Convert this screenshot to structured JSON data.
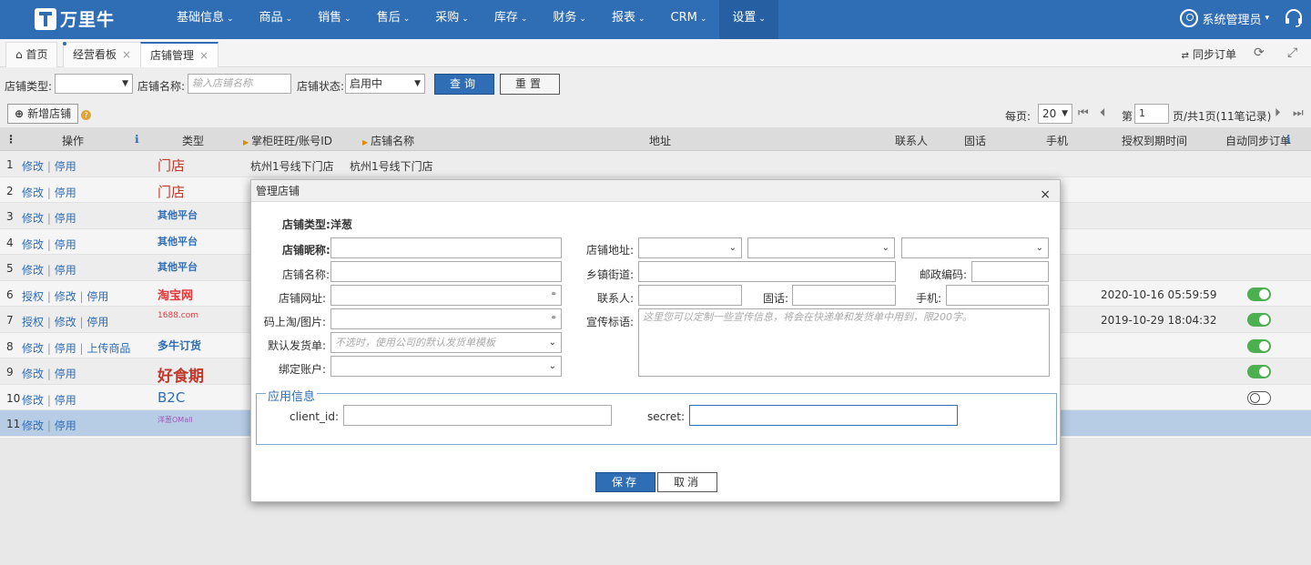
{
  "app": {
    "logo_text": "万里牛"
  },
  "nav": {
    "items": [
      "基础信息",
      "商品",
      "销售",
      "售后",
      "采购",
      "库存",
      "财务",
      "报表",
      "CRM",
      "设置"
    ],
    "active_index": 9
  },
  "user": {
    "name": "系统管理员"
  },
  "tabs": [
    {
      "label": "首页"
    },
    {
      "label": "经营看板"
    },
    {
      "label": "店铺管理"
    }
  ],
  "tabbar": {
    "sync_label": "同步订单"
  },
  "filters": {
    "shop_type_label": "店铺类型:",
    "shop_type_value": "",
    "shop_name_label": "店铺名称:",
    "shop_name_placeholder": "输入店铺名称",
    "shop_status_label": "店铺状态:",
    "shop_status_value": "启用中",
    "query_label": "查询",
    "reset_label": "重置"
  },
  "toolbar": {
    "add_label": "新增店铺"
  },
  "pager": {
    "per_page_label": "每页:",
    "per_page_value": "20",
    "page_prefix": "第",
    "page_value": "1",
    "page_suffix": "页/共1页(11笔记录)"
  },
  "table": {
    "headers": {
      "actions": "操作",
      "type": "类型",
      "account": "掌柜旺旺/账号ID",
      "shop_name": "店铺名称",
      "address": "地址",
      "contact": "联系人",
      "phone": "固话",
      "mobile": "手机",
      "expiry": "授权到期时间",
      "auto_sync": "自动同步订单"
    },
    "rows": [
      {
        "no": "1",
        "actions": [
          "修改",
          "停用"
        ],
        "type": "门店",
        "account": "杭州1号线下门店",
        "shop_name": "杭州1号线下门店",
        "expiry": "",
        "sync": null
      },
      {
        "no": "2",
        "actions": [
          "修改",
          "停用"
        ],
        "type": "门店",
        "account": "",
        "shop_name": "",
        "expiry": "",
        "sync": null
      },
      {
        "no": "3",
        "actions": [
          "修改",
          "停用"
        ],
        "type": "其他平台",
        "account": "",
        "shop_name": "",
        "expiry": "",
        "sync": null
      },
      {
        "no": "4",
        "actions": [
          "修改",
          "停用"
        ],
        "type": "其他平台",
        "account": "",
        "shop_name": "",
        "expiry": "",
        "sync": null
      },
      {
        "no": "5",
        "actions": [
          "修改",
          "停用"
        ],
        "type": "其他平台",
        "account": "",
        "shop_name": "",
        "expiry": "",
        "sync": null
      },
      {
        "no": "6",
        "actions": [
          "授权",
          "修改",
          "停用"
        ],
        "type": "淘宝网",
        "account": "",
        "shop_name": "",
        "expiry": "2020-10-16 05:59:59",
        "sync": true
      },
      {
        "no": "7",
        "actions": [
          "授权",
          "修改",
          "停用"
        ],
        "type": "1688.com",
        "account": "",
        "shop_name": "",
        "expiry": "2019-10-29 18:04:32",
        "sync": true
      },
      {
        "no": "8",
        "actions": [
          "修改",
          "停用",
          "上传商品"
        ],
        "type": "多牛订货",
        "account": "",
        "shop_name": "",
        "expiry": "",
        "sync": true
      },
      {
        "no": "9",
        "actions": [
          "修改",
          "停用"
        ],
        "type": "好食期",
        "account": "",
        "shop_name": "",
        "expiry": "",
        "sync": true
      },
      {
        "no": "10",
        "actions": [
          "修改",
          "停用"
        ],
        "type": "B2C",
        "account": "",
        "shop_name": "",
        "expiry": "",
        "sync": false
      },
      {
        "no": "11",
        "actions": [
          "修改",
          "停用"
        ],
        "type": "洋葱OMall",
        "account": "",
        "shop_name": "",
        "expiry": "",
        "sync": null
      }
    ]
  },
  "modal": {
    "title": "管理店铺",
    "close": "×",
    "shop_type_label": "店铺类型:",
    "shop_type_value": "洋葱",
    "nickname_label": "店铺昵称:",
    "name_label": "店铺名称:",
    "url_label": "店铺网址:",
    "qr_label": "码上淘/图片:",
    "default_waybill_label": "默认发货单:",
    "default_waybill_placeholder": "不选时，使用公司的默认发货单模板",
    "bind_account_label": "绑定账户:",
    "address_label": "店铺地址:",
    "street_label": "乡镇街道:",
    "postcode_label": "邮政编码:",
    "contact_label": "联系人:",
    "phone_label": "固话:",
    "mobile_label": "手机:",
    "slogan_label": "宣传标语:",
    "slogan_placeholder": "这里您可以定制一些宣传信息，将会在快递单和发货单中用到，限200字。",
    "app_info_legend": "应用信息",
    "client_id_label": "client_id:",
    "secret_label": "secret:",
    "save_label": "保存",
    "cancel_label": "取消"
  },
  "colors": {
    "primary": "#2f6db5",
    "toggle_on": "#4caf50",
    "selected_row": "#b7cde6",
    "required_marker": "#e08a00"
  }
}
